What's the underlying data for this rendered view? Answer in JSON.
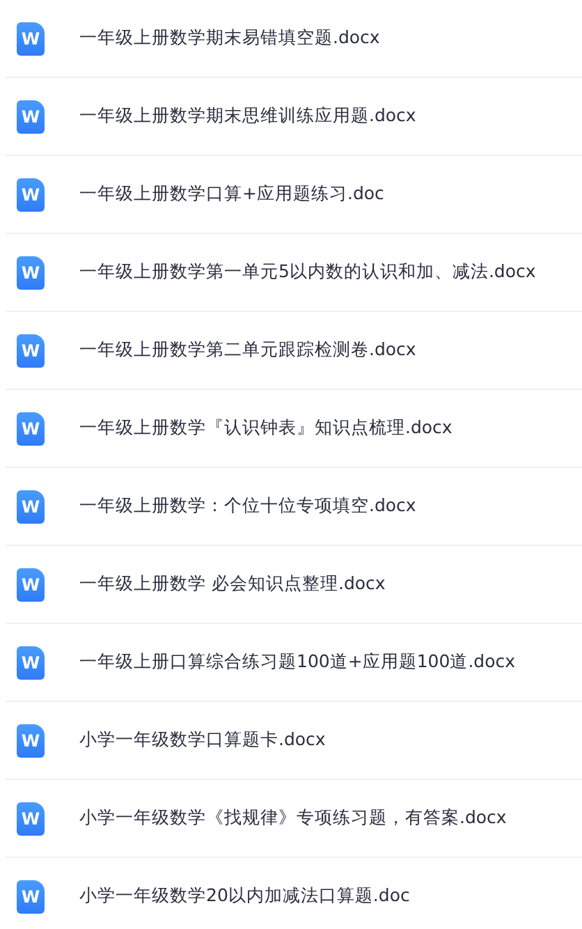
{
  "files": [
    {
      "icon_label": "W",
      "name": "一年级上册数学期末易错填空题.docx"
    },
    {
      "icon_label": "W",
      "name": "一年级上册数学期末思维训练应用题.docx"
    },
    {
      "icon_label": "W",
      "name": "一年级上册数学口算+应用题练习.doc"
    },
    {
      "icon_label": "W",
      "name": "一年级上册数学第一单元5以内数的认识和加、减法.docx"
    },
    {
      "icon_label": "W",
      "name": "一年级上册数学第二单元跟踪检测卷.docx"
    },
    {
      "icon_label": "W",
      "name": "一年级上册数学『认识钟表』知识点梳理.docx"
    },
    {
      "icon_label": "W",
      "name": "一年级上册数学：个位十位专项填空.docx"
    },
    {
      "icon_label": "W",
      "name": "一年级上册数学 必会知识点整理.docx"
    },
    {
      "icon_label": "W",
      "name": "一年级上册口算综合练习题100道+应用题100道.docx"
    },
    {
      "icon_label": "W",
      "name": "小学一年级数学口算题卡.docx"
    },
    {
      "icon_label": "W",
      "name": "小学一年级数学《找规律》专项练习题，有答案.docx"
    },
    {
      "icon_label": "W",
      "name": "小学一年级数学20以内加减法口算题.doc"
    }
  ]
}
